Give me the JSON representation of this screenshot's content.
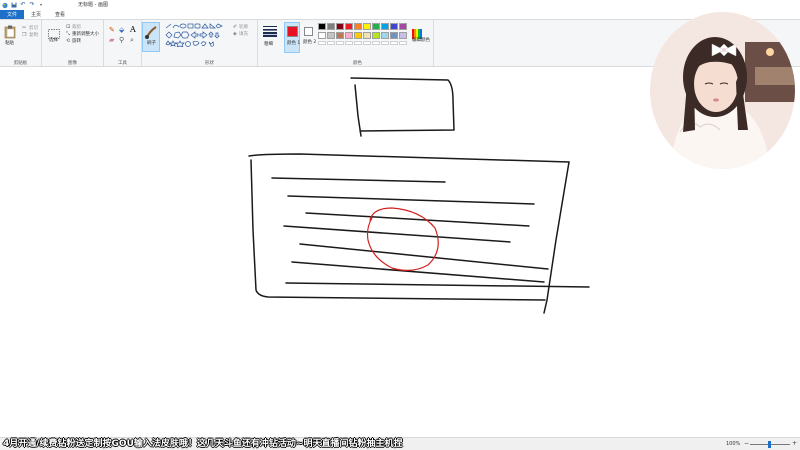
{
  "titlebar": {
    "title": "无标题 - 画图",
    "qa_icons": [
      "paint-app-icon",
      "save-icon",
      "undo-icon",
      "redo-icon",
      "dropdown-icon"
    ]
  },
  "tabs": [
    {
      "label": "文件",
      "active": true
    },
    {
      "label": "主页",
      "active": false
    },
    {
      "label": "查看",
      "active": false
    }
  ],
  "ribbon": {
    "clipboard": {
      "paste": "粘贴",
      "cut": "剪切",
      "copy": "复制",
      "label": "剪贴板"
    },
    "image": {
      "select": "选择",
      "crop": "裁剪",
      "resize": "重新调整大小",
      "rotate": "旋转",
      "label": "图像"
    },
    "tools": {
      "label": "工具",
      "brush": "刷子"
    },
    "shapes": {
      "outline": "轮廓",
      "fill": "填充",
      "label": "形状"
    },
    "size": {
      "label": "粗细"
    },
    "colors": {
      "color1": "颜色 1",
      "color2": "颜色 2",
      "edit": "编辑颜色",
      "label": "颜色",
      "color1_value": "#e81123",
      "color2_value": "#ffffff",
      "palette_row1": [
        "#000000",
        "#7f7f7f",
        "#880015",
        "#ed1c24",
        "#ff7f27",
        "#fff200",
        "#22b14c",
        "#00a2e8",
        "#3f48cc",
        "#a349a4"
      ],
      "palette_row2": [
        "#ffffff",
        "#c3c3c3",
        "#b97a57",
        "#ffaec9",
        "#ffc90e",
        "#efe4b0",
        "#b5e61d",
        "#99d9ea",
        "#7092be",
        "#c8bfe7"
      ]
    }
  },
  "banner": {
    "text": "4月开通/续费钻粉送定制按GOU输入法皮肤哦！这几天斗鱼还有冲钻活动~明天直播间钻粉抽主机捏"
  },
  "statusbar": {
    "zoom": "100%"
  },
  "colors": {
    "accent": "#1e6fc8",
    "ink": "#1a1a1a",
    "red_ink": "#d42020"
  }
}
